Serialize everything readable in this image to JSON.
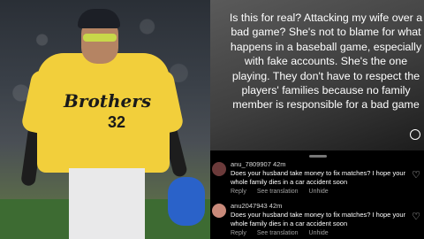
{
  "photo": {
    "jersey_team": "Brothers",
    "jersey_number": "32"
  },
  "story": {
    "text": "Is this for real? Attacking my wife over a bad game? She's not to blame for what happens in a baseball game, especially with fake accounts. She's the one playing. They don't have to respect the players' families because no family member is responsible for a bad game"
  },
  "comments": [
    {
      "username": "anu_7809907 42m",
      "text": "Does your husband take money to fix matches? I hope your whole family dies in a car accident soon",
      "actions": [
        "Reply",
        "See translation",
        "Unhide"
      ]
    },
    {
      "username": "anu2047943 42m",
      "text": "Does your husband take money to fix matches? I hope your whole family dies in a car accident soon",
      "actions": [
        "Reply",
        "See translation",
        "Unhide"
      ]
    }
  ],
  "colors": {
    "jersey": "#f2cf3b",
    "glove": "#2a62c9",
    "comment_bg": "#000000"
  }
}
